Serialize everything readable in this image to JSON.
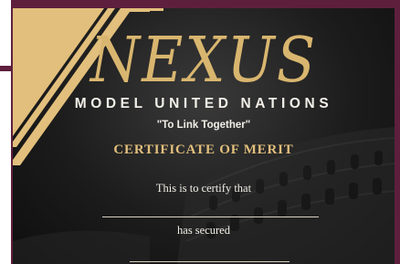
{
  "certificate": {
    "logo": "NEXUS",
    "subtitle": "MODEL UNITED NATIONS",
    "tagline": "\"To Link Together\"",
    "title": "CERTIFICATE OF MERIT",
    "certify_text": "This is to certify that",
    "secured_text": "has secured"
  },
  "colors": {
    "gold": "#e2bf7c",
    "logo_gold": "#d9b66f",
    "text_white": "#f2efe8",
    "frame": "#5e1f3c",
    "background": "#1c1c1c",
    "line": "#d9d0bf"
  }
}
